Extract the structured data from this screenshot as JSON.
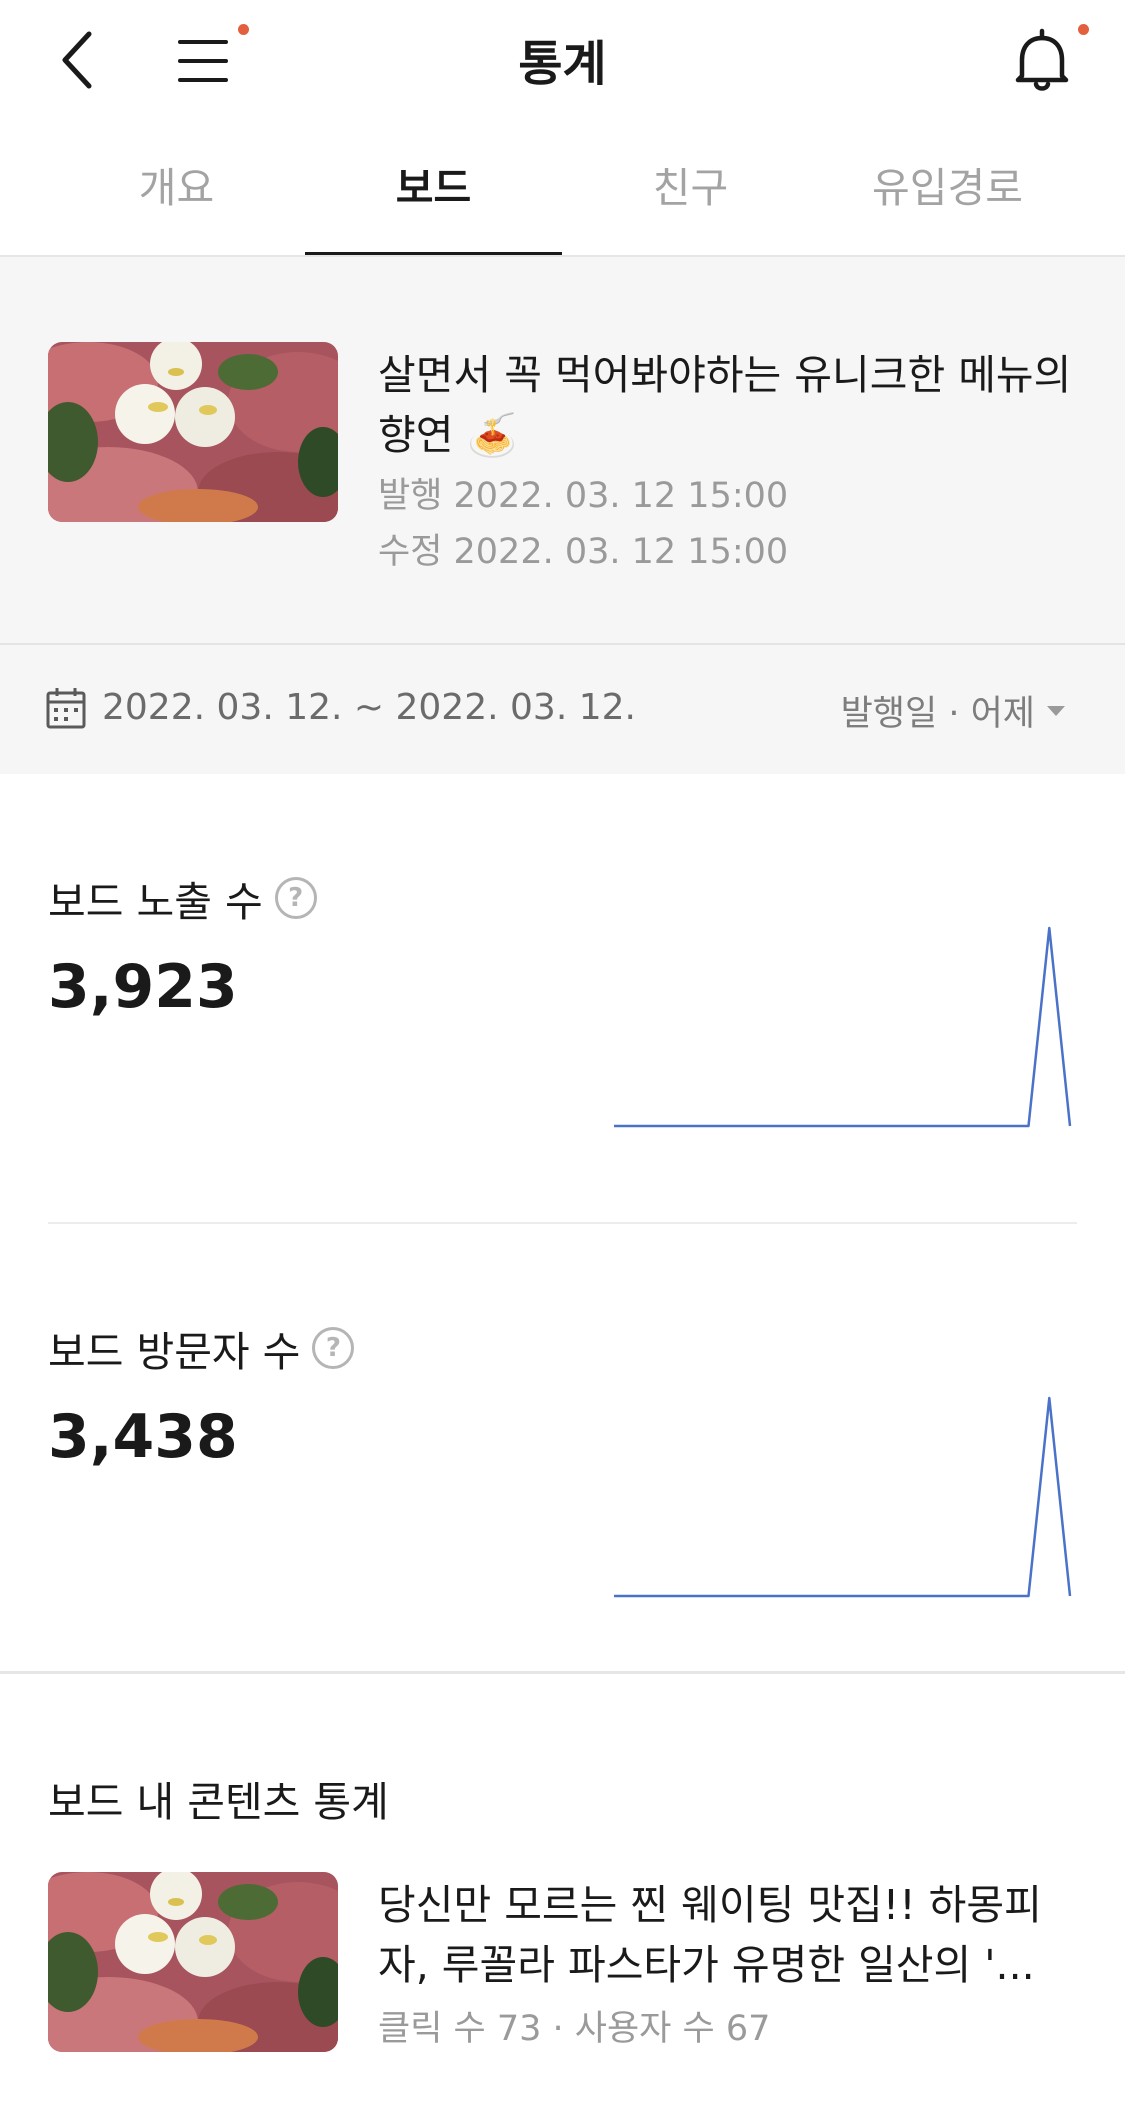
{
  "header": {
    "title": "통계",
    "has_menu_badge": true,
    "has_notification_badge": true,
    "badge_color": "#e3603f"
  },
  "tabs": [
    {
      "label": "개요",
      "active": false
    },
    {
      "label": "보드",
      "active": true
    },
    {
      "label": "친구",
      "active": false
    },
    {
      "label": "유입경로",
      "active": false
    }
  ],
  "post": {
    "title": "살면서 꼭 먹어봐야하는 유니크한 메뉴의 향연 🍝",
    "published": "발행 2022. 03. 12 15:00",
    "edited": "수정 2022. 03. 12 15:00"
  },
  "date_filter": {
    "range": "2022. 03. 12. ~ 2022. 03. 12.",
    "selector": "발행일 · 어제"
  },
  "stats": [
    {
      "label": "보드 노출 수",
      "value": "3,923"
    },
    {
      "label": "보드 방문자 수",
      "value": "3,438"
    }
  ],
  "chart_data": [
    {
      "type": "line",
      "series": [
        {
          "values": [
            0,
            0,
            0,
            0,
            0,
            0,
            0,
            0,
            0,
            0,
            0,
            0,
            0,
            0,
            0,
            0,
            0,
            0,
            0,
            0,
            0,
            3923,
            0
          ]
        }
      ],
      "grid": false,
      "color": "#4a72c8"
    },
    {
      "type": "line",
      "series": [
        {
          "values": [
            0,
            0,
            0,
            0,
            0,
            0,
            0,
            0,
            0,
            0,
            0,
            0,
            0,
            0,
            0,
            0,
            0,
            0,
            0,
            0,
            0,
            3438,
            0
          ]
        }
      ],
      "grid": false,
      "color": "#4a72c8"
    }
  ],
  "contents": {
    "section_title": "보드 내 콘텐츠 통계",
    "items": [
      {
        "title": "당신만 모르는 찐 웨이팅 맛집!! 하몽피자, 루꼴라 파스타가 유명한 일산의 '...",
        "meta": "클릭 수 73 · 사용자 수 67"
      }
    ]
  },
  "colors": {
    "accent_line": "#4a72c8",
    "active_tab": "#1a1a1a",
    "inactive_tab": "#a3a3a3"
  }
}
